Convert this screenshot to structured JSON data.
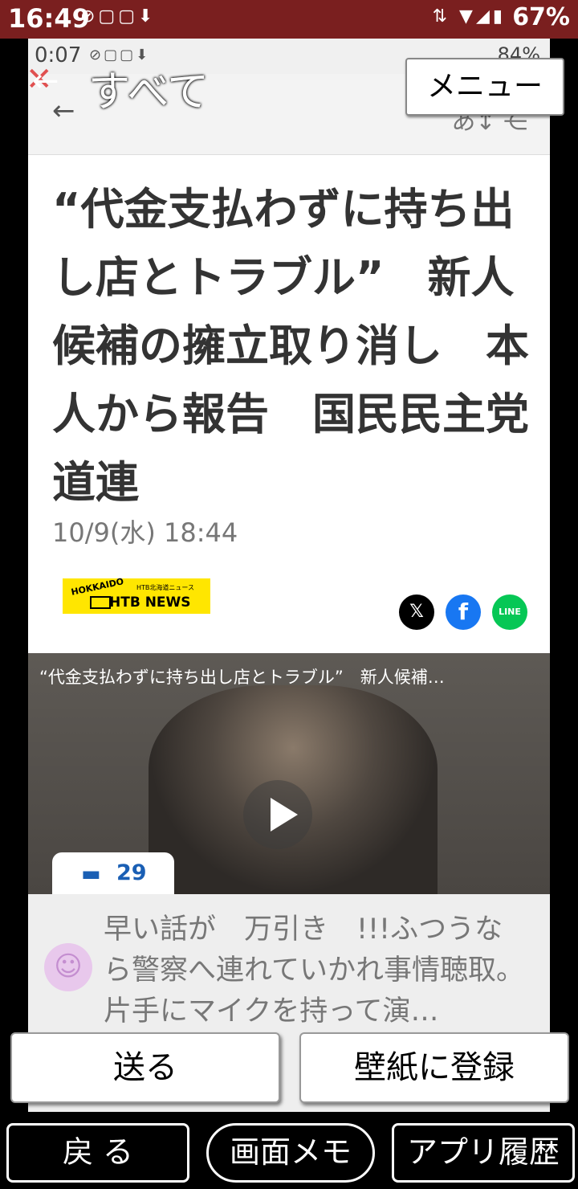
{
  "status_bar": {
    "time": "16:49",
    "battery": "67%",
    "left_icons": "⊘▢▢⬇",
    "right_icons": "⇅ ▼◢▮"
  },
  "screenshot": {
    "inner_status": {
      "time": "0:07",
      "battery": "84%",
      "icons": "⊘▢▢⬇"
    },
    "headline": "“代金支払わずに持ち出し店とトラブル”　新人候補の擁立取り消し　本人から報告　国民民主党道連",
    "timestamp": "10/9(水) 18:44",
    "source_logo": {
      "top": "HOKKAIDO",
      "sub": "HTB北海道ニュース",
      "main": "HTB NEWS"
    },
    "share": {
      "x": "𝕏",
      "facebook": "f",
      "line": "LINE"
    },
    "video": {
      "title": "“代金支払わずに持ち出し店とトラブル”　新人候補…"
    },
    "comments": {
      "count": "29",
      "avatar": "☺",
      "first_comment": "早い話が　万引き　!!!ふつうなら警察へ連れていかれ事情聴取。片手にマイクを持って演…"
    }
  },
  "overlay": {
    "title": "すべて",
    "menu_label": "メニュー",
    "send_label": "送る",
    "wallpaper_label": "壁紙に登録"
  },
  "bottom_nav": {
    "back_label": "戻 る",
    "memo_label": "画面メモ",
    "history_label": "アプリ履歴"
  },
  "colors": {
    "status_bar": "#7a1f1f",
    "accent_blue": "#1a5fb4",
    "logo_yellow": "#ffe600",
    "facebook": "#1877f2",
    "line": "#06c755"
  }
}
